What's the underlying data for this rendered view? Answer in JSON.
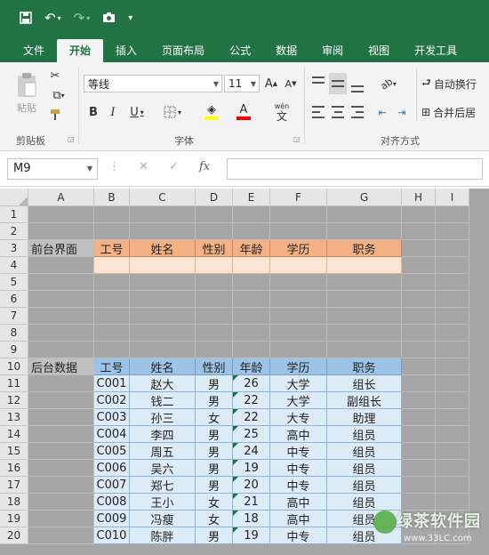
{
  "ribbon_tabs": [
    {
      "label": "文件",
      "active": false
    },
    {
      "label": "开始",
      "active": true
    },
    {
      "label": "插入",
      "active": false
    },
    {
      "label": "页面布局",
      "active": false
    },
    {
      "label": "公式",
      "active": false
    },
    {
      "label": "数据",
      "active": false
    },
    {
      "label": "审阅",
      "active": false
    },
    {
      "label": "视图",
      "active": false
    },
    {
      "label": "开发工具",
      "active": false
    }
  ],
  "ribbon": {
    "paste_label": "粘贴",
    "clipboard_group": "剪贴板",
    "font_group": "字体",
    "alignment_group": "对齐方式",
    "font_name": "等线",
    "font_size": "11",
    "bold": "B",
    "italic": "I",
    "underline": "U",
    "grow_font": "A",
    "shrink_font": "A",
    "font_color_letter": "A",
    "pinyin": "wén",
    "pinyin_char": "文",
    "wrap_text": "自动换行",
    "merge_center": "合并后居"
  },
  "formula_bar": {
    "name_box": "M9",
    "fx": "fx",
    "formula": ""
  },
  "columns": [
    "A",
    "B",
    "C",
    "D",
    "E",
    "F",
    "G",
    "H",
    "I"
  ],
  "rows": [
    {
      "n": "1",
      "cells": [
        "",
        "",
        "",
        "",
        "",
        "",
        ""
      ]
    },
    {
      "n": "2",
      "cells": [
        "",
        "",
        "",
        "",
        "",
        "",
        ""
      ]
    },
    {
      "n": "3",
      "cells": [
        "前台界面",
        "工号",
        "姓名",
        "性别",
        "年龄",
        "学历",
        "职务"
      ]
    },
    {
      "n": "4",
      "cells": [
        "",
        "",
        "",
        "",
        "",
        "",
        ""
      ]
    },
    {
      "n": "5",
      "cells": [
        "",
        "",
        "",
        "",
        "",
        "",
        ""
      ]
    },
    {
      "n": "6",
      "cells": [
        "",
        "",
        "",
        "",
        "",
        "",
        ""
      ]
    },
    {
      "n": "7",
      "cells": [
        "",
        "",
        "",
        "",
        "",
        "",
        ""
      ]
    },
    {
      "n": "8",
      "cells": [
        "",
        "",
        "",
        "",
        "",
        "",
        ""
      ]
    },
    {
      "n": "9",
      "cells": [
        "",
        "",
        "",
        "",
        "",
        "",
        ""
      ]
    },
    {
      "n": "10",
      "cells": [
        "后台数据",
        "工号",
        "姓名",
        "性别",
        "年龄",
        "学历",
        "职务"
      ]
    },
    {
      "n": "11",
      "cells": [
        "",
        "C001",
        "赵大",
        "男",
        "26",
        "大学",
        "组长"
      ]
    },
    {
      "n": "12",
      "cells": [
        "",
        "C002",
        "钱二",
        "男",
        "22",
        "大学",
        "副组长"
      ]
    },
    {
      "n": "13",
      "cells": [
        "",
        "C003",
        "孙三",
        "女",
        "22",
        "大专",
        "助理"
      ]
    },
    {
      "n": "14",
      "cells": [
        "",
        "C004",
        "李四",
        "男",
        "25",
        "高中",
        "组员"
      ]
    },
    {
      "n": "15",
      "cells": [
        "",
        "C005",
        "周五",
        "男",
        "24",
        "中专",
        "组员"
      ]
    },
    {
      "n": "16",
      "cells": [
        "",
        "C006",
        "吴六",
        "男",
        "19",
        "中专",
        "组员"
      ]
    },
    {
      "n": "17",
      "cells": [
        "",
        "C007",
        "郑七",
        "男",
        "20",
        "中专",
        "组员"
      ]
    },
    {
      "n": "18",
      "cells": [
        "",
        "C008",
        "王小",
        "女",
        "21",
        "高中",
        "组员"
      ]
    },
    {
      "n": "19",
      "cells": [
        "",
        "C009",
        "冯瘦",
        "女",
        "18",
        "高中",
        "组员"
      ]
    },
    {
      "n": "20",
      "cells": [
        "",
        "C010",
        "陈胖",
        "男",
        "19",
        "中专",
        "组员"
      ]
    }
  ],
  "watermark": {
    "name": "绿茶软件园",
    "url": "www.33LC.com"
  },
  "colors": {
    "brand": "#217346",
    "orange_header": "#f4b183",
    "orange_light": "#fbe5d6",
    "blue_header": "#9dc3e6",
    "blue_light": "#ddebf7",
    "grid_gray": "#a6a6a6",
    "label_cell": "#bfbfbf"
  }
}
